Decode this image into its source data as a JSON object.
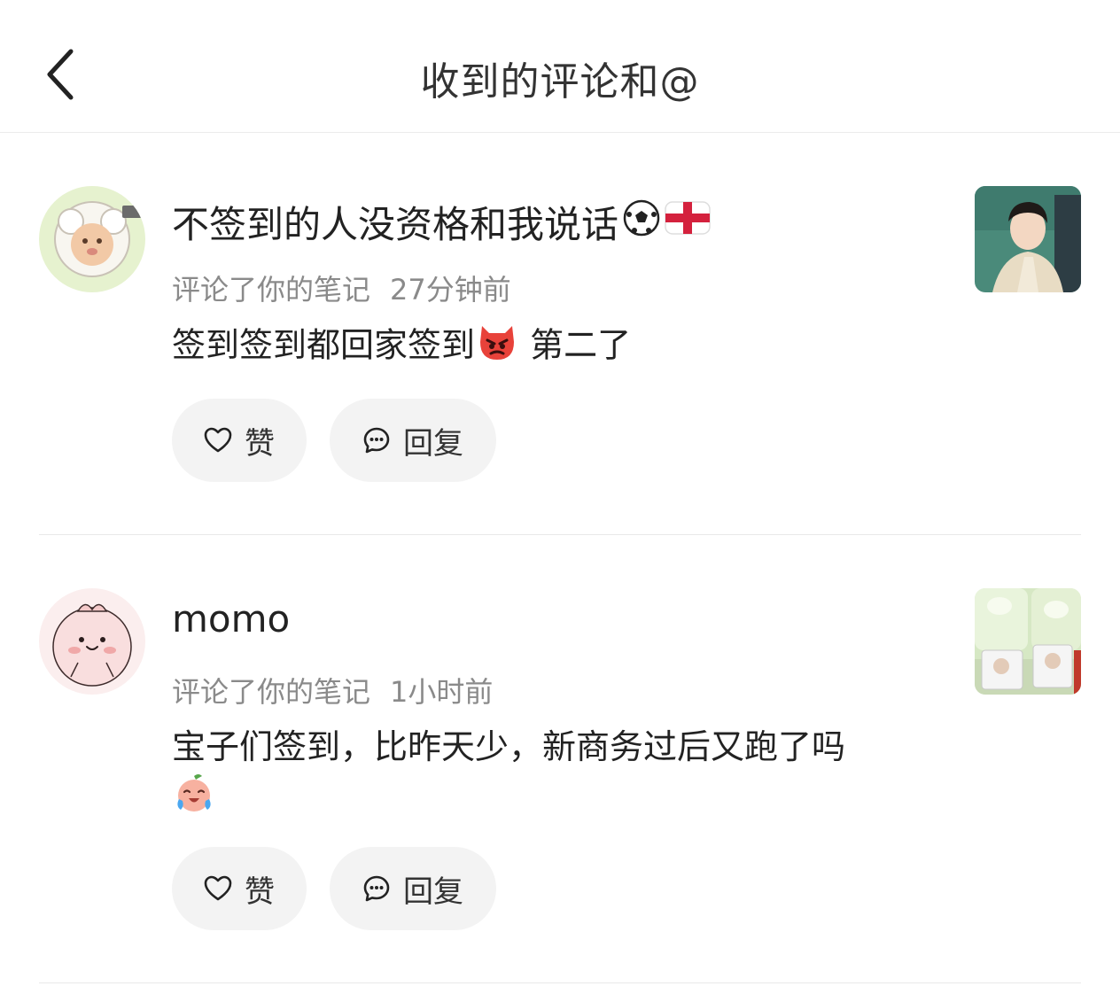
{
  "header": {
    "title": "收到的评论和@"
  },
  "comments": [
    {
      "username": "不签到的人没资格和我说话",
      "action": "评论了你的笔记",
      "time": "27分钟前",
      "text_before": "签到签到都回家签到",
      "text_after": "第二了",
      "like_label": "赞",
      "reply_label": "回复",
      "icons": [
        "soccer-ball-icon",
        "england-flag-icon",
        "angry-face-emoji"
      ]
    },
    {
      "username": "momo",
      "action": "评论了你的笔记",
      "time": "1小时前",
      "text": "宝子们签到，比昨天少，新商务过后又跑了吗",
      "like_label": "赞",
      "reply_label": "回复",
      "icons": [
        "crying-peach-emoji"
      ]
    }
  ]
}
